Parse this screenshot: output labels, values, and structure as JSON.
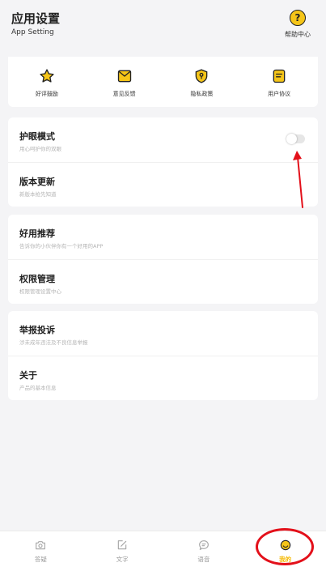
{
  "header": {
    "title": "应用设置",
    "subtitle": "App Setting",
    "help_label": "帮助中心",
    "help_icon": "question-icon"
  },
  "quick_actions": [
    {
      "label": "好评鼓励",
      "icon": "star-icon"
    },
    {
      "label": "意见反馈",
      "icon": "mail-icon"
    },
    {
      "label": "隐私政策",
      "icon": "shield-icon"
    },
    {
      "label": "用户协议",
      "icon": "document-icon"
    }
  ],
  "groups": [
    {
      "rows": [
        {
          "title": "护眼模式",
          "desc": "用心呵护你的双眼",
          "toggle": true,
          "toggle_on": false
        },
        {
          "title": "版本更新",
          "desc": "新版本抢先知道"
        }
      ]
    },
    {
      "rows": [
        {
          "title": "好用推荐",
          "desc": "告诉你的小伙伴你有一个好用的APP"
        },
        {
          "title": "权限管理",
          "desc": "权限管理设置中心"
        }
      ]
    },
    {
      "rows": [
        {
          "title": "举报投诉",
          "desc": "涉未成年违法及不良信息举报"
        },
        {
          "title": "关于",
          "desc": "产品的基本信息"
        }
      ]
    }
  ],
  "tabs": [
    {
      "label": "答疑",
      "icon": "camera-icon",
      "active": false
    },
    {
      "label": "文字",
      "icon": "edit-icon",
      "active": false
    },
    {
      "label": "语音",
      "icon": "chat-bubble-icon",
      "active": false
    },
    {
      "label": "我的",
      "icon": "profile-smile-icon",
      "active": true
    }
  ],
  "colors": {
    "accent": "#f5b800",
    "annotation": "#e3101a",
    "background": "#f4f4f6"
  }
}
